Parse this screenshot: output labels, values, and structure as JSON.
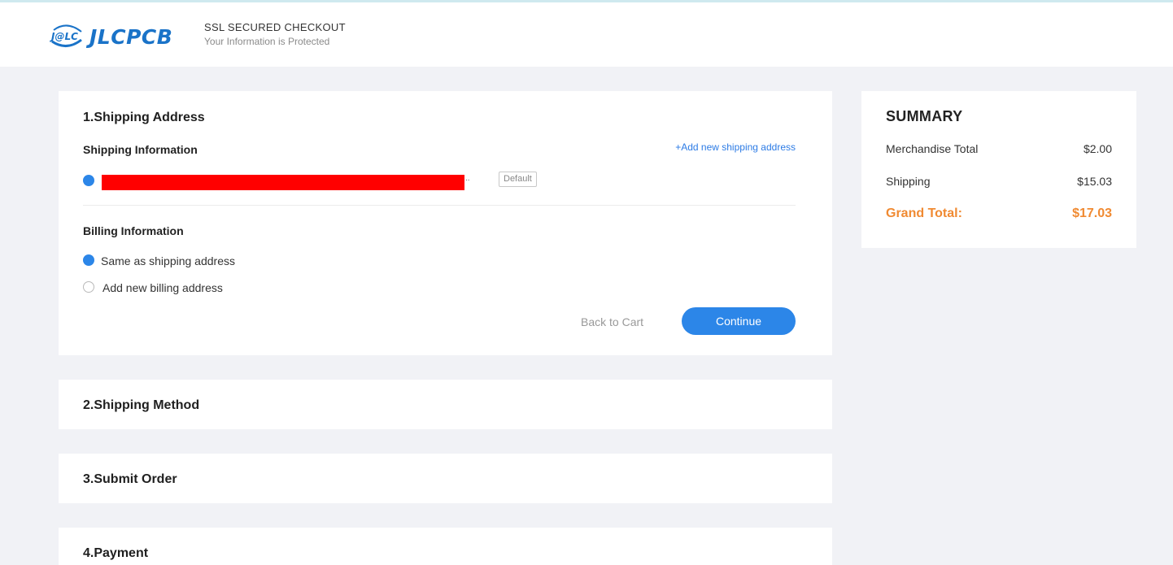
{
  "header": {
    "logo_text": "JLCPCB",
    "logo_mark": "J@LC",
    "ssl_title": "SSL SECURED CHECKOUT",
    "ssl_subtitle": "Your Information is Protected"
  },
  "shipping_address": {
    "title": "1.Shipping Address",
    "info_label": "Shipping Information",
    "add_link": "+Add new shipping address",
    "ellipsis": "..",
    "default_badge": "Default",
    "billing_label": "Billing Information",
    "billing_options": [
      {
        "label": "Same as shipping address",
        "selected": true
      },
      {
        "label": "Add new billing address",
        "selected": false
      }
    ],
    "back_label": "Back to Cart",
    "continue_label": "Continue"
  },
  "steps": [
    {
      "title": "2.Shipping Method"
    },
    {
      "title": "3.Submit Order"
    },
    {
      "title": "4.Payment"
    }
  ],
  "summary": {
    "title": "SUMMARY",
    "merch_label": "Merchandise Total",
    "merch_value": "$2.00",
    "shipping_label": "Shipping",
    "shipping_value": "$15.03",
    "total_label": "Grand Total:",
    "total_value": "$17.03"
  },
  "colors": {
    "accent": "#2c86e8",
    "total": "#f08a32",
    "redaction": "#ff0000",
    "background": "#f1f2f6"
  }
}
